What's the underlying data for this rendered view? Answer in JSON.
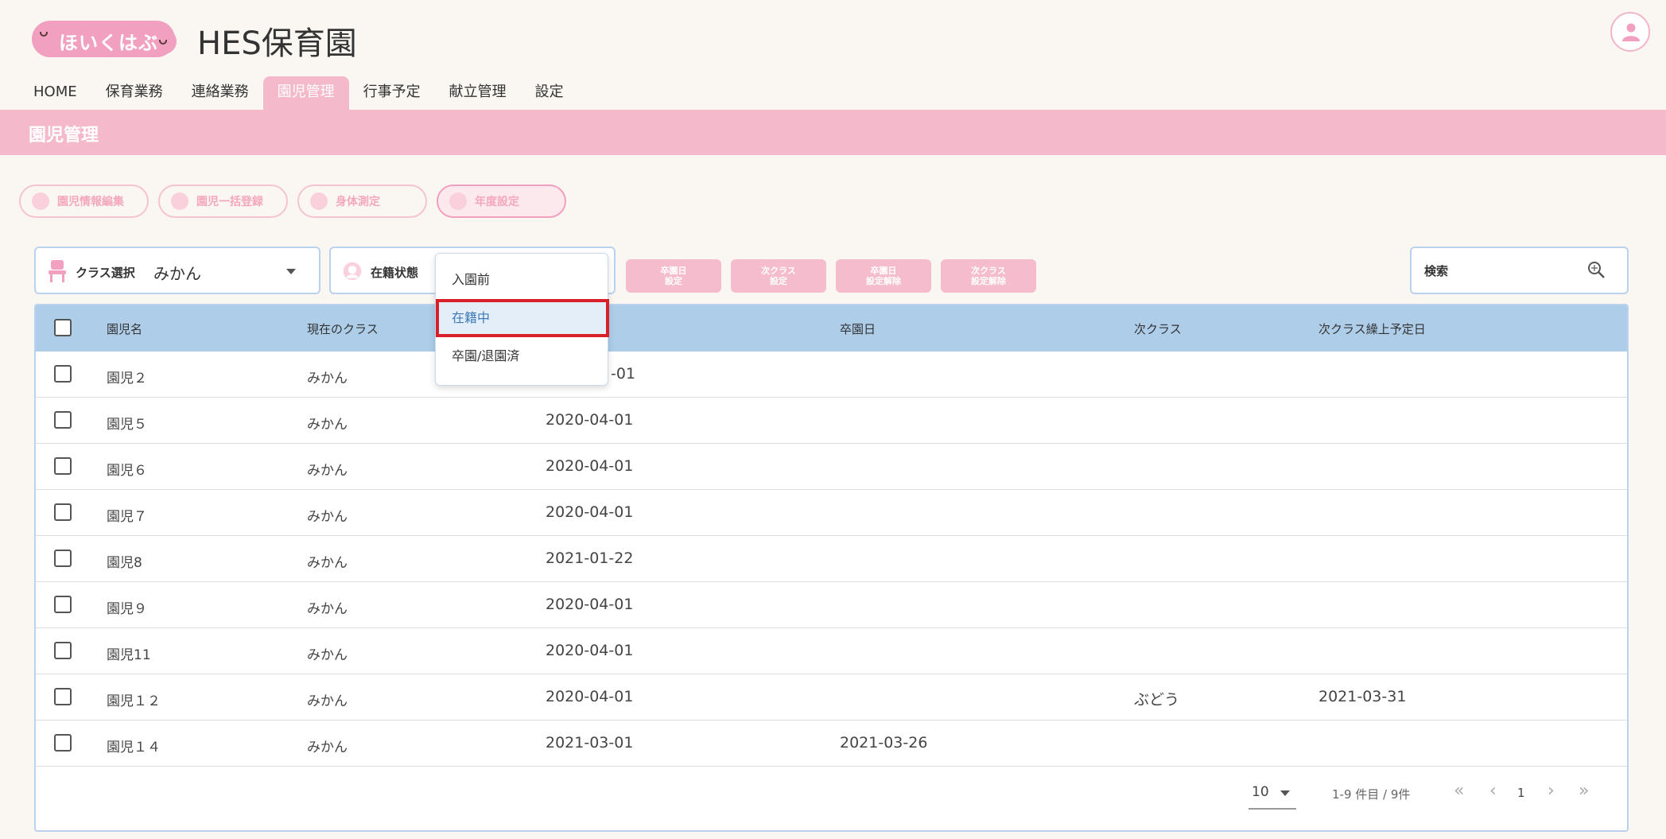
{
  "app": {
    "logo_text": "ほいくはぶ",
    "title": "HES保育園"
  },
  "nav": [
    {
      "label": "HOME"
    },
    {
      "label": "保育業務"
    },
    {
      "label": "連絡業務"
    },
    {
      "label": "園児管理",
      "active": true
    },
    {
      "label": "行事予定"
    },
    {
      "label": "献立管理"
    },
    {
      "label": "設定"
    }
  ],
  "page": {
    "title": "園児管理"
  },
  "actions": [
    {
      "label": "園児情報編集"
    },
    {
      "label": "園児一括登録"
    },
    {
      "label": "身体測定"
    },
    {
      "label": "年度設定"
    }
  ],
  "filters": {
    "class": {
      "label": "クラス選択",
      "value": "みかん"
    },
    "status": {
      "label": "在籍状態"
    }
  },
  "status_options": [
    {
      "label": "入園前"
    },
    {
      "label": "在籍中",
      "selected": true
    },
    {
      "label": "卒園/退園済"
    }
  ],
  "pink_buttons": [
    {
      "line1": "卒園日",
      "line2": "設定"
    },
    {
      "line1": "次クラス",
      "line2": "設定"
    },
    {
      "line1": "卒園日",
      "line2": "設定解除"
    },
    {
      "line1": "次クラス",
      "line2": "設定解除"
    }
  ],
  "search": {
    "placeholder": "検索"
  },
  "table": {
    "headers": [
      "園児名",
      "現在のクラス",
      "",
      "卒園日",
      "次クラス",
      "次クラス繰上予定日"
    ],
    "rows": [
      {
        "name": "園児２",
        "class": "みかん",
        "date": "-01",
        "grad": "",
        "next": "",
        "next_date": ""
      },
      {
        "name": "園児５",
        "class": "みかん",
        "date": "2020-04-01",
        "grad": "",
        "next": "",
        "next_date": ""
      },
      {
        "name": "園児６",
        "class": "みかん",
        "date": "2020-04-01",
        "grad": "",
        "next": "",
        "next_date": ""
      },
      {
        "name": "園児７",
        "class": "みかん",
        "date": "2020-04-01",
        "grad": "",
        "next": "",
        "next_date": ""
      },
      {
        "name": "園児8",
        "class": "みかん",
        "date": "2021-01-22",
        "grad": "",
        "next": "",
        "next_date": ""
      },
      {
        "name": "園児９",
        "class": "みかん",
        "date": "2020-04-01",
        "grad": "",
        "next": "",
        "next_date": ""
      },
      {
        "name": "園児11",
        "class": "みかん",
        "date": "2020-04-01",
        "grad": "",
        "next": "",
        "next_date": ""
      },
      {
        "name": "園児１２",
        "class": "みかん",
        "date": "2020-04-01",
        "grad": "",
        "next": "ぶどう",
        "next_date": "2021-03-31"
      },
      {
        "name": "園児１４",
        "class": "みかん",
        "date": "2021-03-01",
        "grad": "2021-03-26",
        "next": "",
        "next_date": ""
      }
    ]
  },
  "pagination": {
    "per_page": "10",
    "range": "1-9 件目 / 9件",
    "page": "1",
    "first": "«",
    "prev": "‹",
    "next": "›",
    "last": "»"
  },
  "colors": {
    "accent_pink": "#f5b9cc",
    "header_blue": "#aecde9",
    "highlight_red": "#d9202a"
  }
}
